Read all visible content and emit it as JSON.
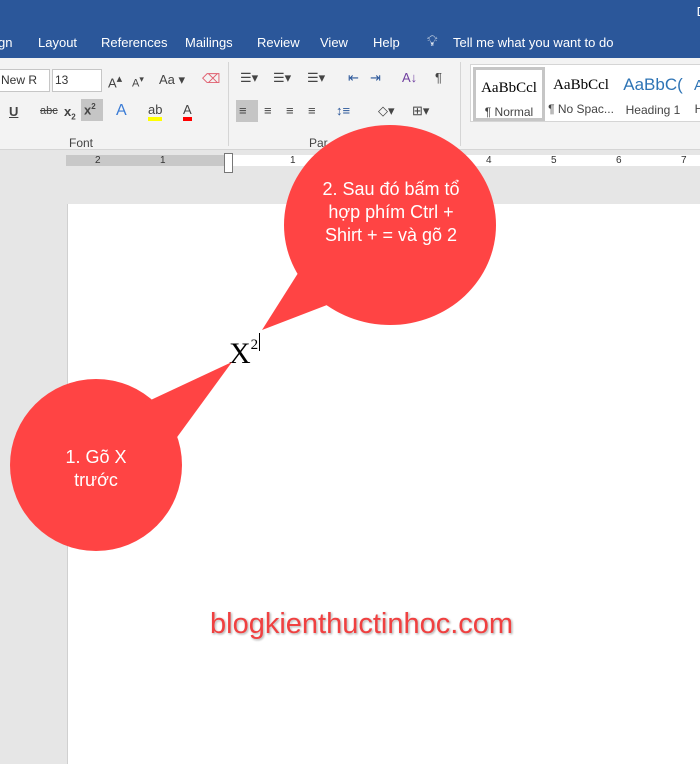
{
  "window": {
    "title": "D"
  },
  "tabs": [
    "gn",
    "Layout",
    "References",
    "Mailings",
    "Review",
    "View",
    "Help"
  ],
  "tell_me": "Tell me what you want to do",
  "font": {
    "name": "New R",
    "size": "13",
    "group_label": "Font"
  },
  "paragraph": {
    "group_label": "Par"
  },
  "styles": [
    {
      "preview": "AaBbCcl",
      "name": "¶ Normal"
    },
    {
      "preview": "AaBbCcl",
      "name": "¶ No Spac..."
    },
    {
      "preview": "AaBbC(",
      "name": "Heading 1"
    },
    {
      "preview": "A",
      "name": "H"
    }
  ],
  "ruler": [
    "2",
    "1",
    "1",
    "4",
    "5",
    "6",
    "7"
  ],
  "document": {
    "base": "X",
    "superscript": "2"
  },
  "callouts": [
    {
      "text": "1. Gõ X trước"
    },
    {
      "text": "2. Sau đó bấm tổ hợp phím Ctrl + Shirt + = và gõ 2"
    }
  ],
  "watermark": "blogkienthuctinhoc.com",
  "colors": {
    "titlebar": "#2b579a",
    "callout": "#ff4444",
    "highlight": "#ffff00",
    "font_color": "#ff0000"
  }
}
